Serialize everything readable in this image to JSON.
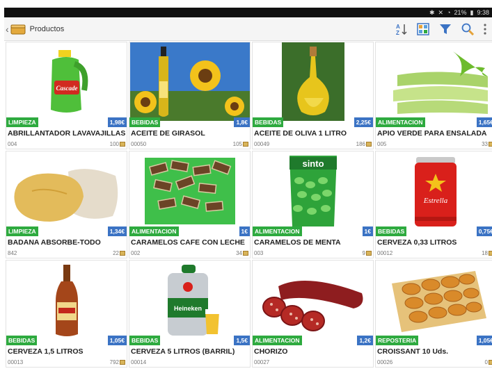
{
  "statusbar": {
    "battery": "21%",
    "time": "9:38"
  },
  "appbar": {
    "title": "Productos"
  },
  "products": [
    {
      "category": "LIMPIEZA",
      "price": "1,98€",
      "name": "ABRILLANTADOR LAVAVAJILLAS",
      "code": "004",
      "stock": "100"
    },
    {
      "category": "BEBIDAS",
      "price": "1,8€",
      "name": "ACEITE DE GIRASOL",
      "code": "00050",
      "stock": "105"
    },
    {
      "category": "BEBIDAS",
      "price": "2,25€",
      "name": "ACEITE DE OLIVA 1 LITRO",
      "code": "00049",
      "stock": "186"
    },
    {
      "category": "ALIMENTACION",
      "price": "1,65€",
      "name": "APIO VERDE PARA ENSALADA",
      "code": "005",
      "stock": "33"
    },
    {
      "category": "LIMPIEZA",
      "price": "1,34€",
      "name": "BADANA ABSORBE-TODO",
      "code": "842",
      "stock": "22"
    },
    {
      "category": "ALIMENTACION",
      "price": "1€",
      "name": "CARAMELOS CAFE CON LECHE",
      "code": "002",
      "stock": "34"
    },
    {
      "category": "ALIMENTACION",
      "price": "1€",
      "name": "CARAMELOS DE MENTA",
      "code": "003",
      "stock": "9"
    },
    {
      "category": "BEBIDAS",
      "price": "0,75€",
      "name": "CERVEZA 0,33 LITROS",
      "code": "00012",
      "stock": "18"
    },
    {
      "category": "BEBIDAS",
      "price": "1,05€",
      "name": "CERVEZA 1,5 LITROS",
      "code": "00013",
      "stock": "792"
    },
    {
      "category": "BEBIDAS",
      "price": "1,5€",
      "name": "CERVEZA 5 LITROS (BARRIL)",
      "code": "00014",
      "stock": ""
    },
    {
      "category": "ALIMENTACION",
      "price": "1,2€",
      "name": "CHORIZO",
      "code": "00027",
      "stock": ""
    },
    {
      "category": "REPOSTERIA",
      "price": "1,05€",
      "name": "CROISSANT 10 Uds.",
      "code": "00026",
      "stock": "0"
    }
  ],
  "image_labels": {
    "cascade": "Cascade",
    "sintoy": "sinto",
    "estrella": "Estrella",
    "heineken": "Heineken"
  }
}
